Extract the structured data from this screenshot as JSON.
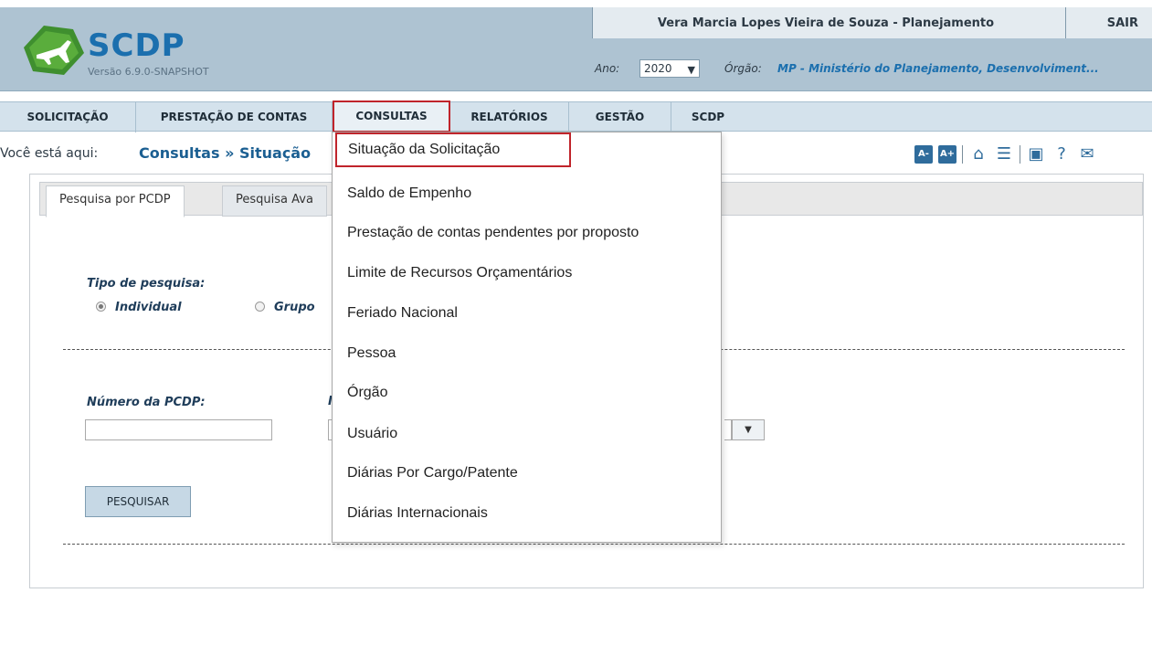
{
  "app": {
    "name": "SCDP",
    "version": "Versão 6.9.0-SNAPSHOT",
    "user_name": "Vera Marcia Lopes Vieira de Souza - Planejamento",
    "logout_label": "SAIR",
    "ano_label": "Ano:",
    "ano_value": "2020",
    "orgao_label": "Órgão:",
    "orgao_value": "MP - Ministério do Planejamento, Desenvolviment..."
  },
  "menu": [
    {
      "label": "SOLICITAÇÃO"
    },
    {
      "label": "PRESTAÇÃO DE CONTAS"
    },
    {
      "label": "CONSULTAS",
      "active": true
    },
    {
      "label": "RELATÓRIOS"
    },
    {
      "label": "GESTÃO"
    },
    {
      "label": "SCDP"
    }
  ],
  "breadcrumb": {
    "label": "Você está aqui:",
    "path": "Consultas » Situação"
  },
  "toolbar": {
    "font_decrease": "A-",
    "font_increase": "A+",
    "icons": [
      "home-icon",
      "chat-icon",
      "screen-icon",
      "help-icon",
      "mail-icon"
    ]
  },
  "tabs": [
    {
      "label": "Pesquisa por PCDP",
      "active": true
    },
    {
      "label": "Pesquisa Ava"
    }
  ],
  "form": {
    "tipo_label": "Tipo de pesquisa:",
    "radio_individual": "Individual",
    "radio_grupo": "Grupo",
    "numero_label": "Número da PCDP:",
    "hidden_label": "I",
    "numero_value": "",
    "search_label": "PESQUISAR"
  },
  "dropdown": {
    "items": [
      {
        "label": "Situação da Solicitação",
        "highlighted": true
      },
      {
        "label": "Saldo de Empenho"
      },
      {
        "label": "Prestação de contas pendentes por proposto"
      },
      {
        "label": "Limite de Recursos Orçamentários"
      },
      {
        "label": "Feriado Nacional"
      },
      {
        "label": "Pessoa"
      },
      {
        "label": "Órgão"
      },
      {
        "label": "Usuário"
      },
      {
        "label": "Diárias Por Cargo/Patente"
      },
      {
        "label": "Diárias Internacionais"
      }
    ]
  },
  "colors": {
    "header_bg": "#aec3d2",
    "brand": "#1b6fae",
    "highlight_border": "#c0242b"
  }
}
